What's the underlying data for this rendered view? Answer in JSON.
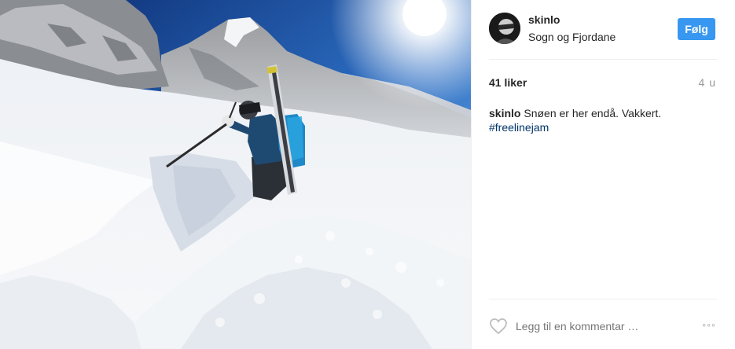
{
  "post": {
    "username": "skinlo",
    "location": "Sogn og Fjordane",
    "follow_label": "Følg",
    "likes": "41 liker",
    "time_ago": "4 u",
    "caption_username": "skinlo",
    "caption_text": " Snøen er her endå. Vakkert.",
    "hashtag": "#freelinejam"
  },
  "comment": {
    "placeholder": "Legg til en kommentar …",
    "more_label": "◦◦◦"
  },
  "icons": {
    "like": "heart-icon",
    "more": "more-options-icon"
  },
  "colors": {
    "follow_button": "#3897f0",
    "hashtag": "#003569",
    "muted": "#999999"
  }
}
